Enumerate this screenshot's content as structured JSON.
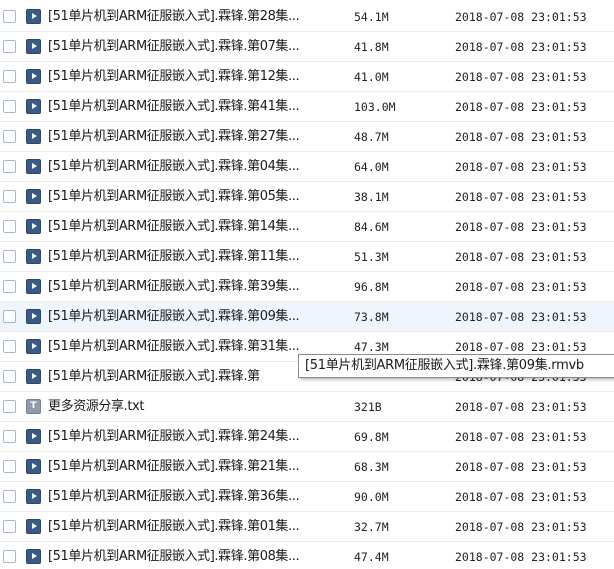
{
  "files": [
    {
      "name": "[51单片机到ARM征服嵌入式].霖锋.第28集...",
      "size": "54.1M",
      "date": "2018-07-08 23:01:53",
      "icon": "video-file-icon"
    },
    {
      "name": "[51单片机到ARM征服嵌入式].霖锋.第07集...",
      "size": "41.8M",
      "date": "2018-07-08 23:01:53",
      "icon": "video-file-icon"
    },
    {
      "name": "[51单片机到ARM征服嵌入式].霖锋.第12集...",
      "size": "41.0M",
      "date": "2018-07-08 23:01:53",
      "icon": "video-file-icon"
    },
    {
      "name": "[51单片机到ARM征服嵌入式].霖锋.第41集...",
      "size": "103.0M",
      "date": "2018-07-08 23:01:53",
      "icon": "video-file-icon"
    },
    {
      "name": "[51单片机到ARM征服嵌入式].霖锋.第27集...",
      "size": "48.7M",
      "date": "2018-07-08 23:01:53",
      "icon": "video-file-icon"
    },
    {
      "name": "[51单片机到ARM征服嵌入式].霖锋.第04集...",
      "size": "64.0M",
      "date": "2018-07-08 23:01:53",
      "icon": "video-file-icon"
    },
    {
      "name": "[51单片机到ARM征服嵌入式].霖锋.第05集...",
      "size": "38.1M",
      "date": "2018-07-08 23:01:53",
      "icon": "video-file-icon"
    },
    {
      "name": "[51单片机到ARM征服嵌入式].霖锋.第14集...",
      "size": "84.6M",
      "date": "2018-07-08 23:01:53",
      "icon": "video-file-icon"
    },
    {
      "name": "[51单片机到ARM征服嵌入式].霖锋.第11集...",
      "size": "51.3M",
      "date": "2018-07-08 23:01:53",
      "icon": "video-file-icon"
    },
    {
      "name": "[51单片机到ARM征服嵌入式].霖锋.第39集...",
      "size": "96.8M",
      "date": "2018-07-08 23:01:53",
      "icon": "video-file-icon"
    },
    {
      "name": "[51单片机到ARM征服嵌入式].霖锋.第09集...",
      "size": "73.8M",
      "date": "2018-07-08 23:01:53",
      "icon": "video-file-icon"
    },
    {
      "name": "[51单片机到ARM征服嵌入式].霖锋.第31集...",
      "size": "47.3M",
      "date": "2018-07-08 23:01:53",
      "icon": "video-file-icon"
    },
    {
      "name": "[51单片机到ARM征服嵌入式].霖锋.第",
      "size": "",
      "date": "2018-07-08 23:01:53",
      "icon": "video-file-icon"
    },
    {
      "name": "更多资源分享.txt",
      "size": "321B",
      "date": "2018-07-08 23:01:53",
      "icon": "text-file-icon"
    },
    {
      "name": "[51单片机到ARM征服嵌入式].霖锋.第24集...",
      "size": "69.8M",
      "date": "2018-07-08 23:01:53",
      "icon": "video-file-icon"
    },
    {
      "name": "[51单片机到ARM征服嵌入式].霖锋.第21集...",
      "size": "68.3M",
      "date": "2018-07-08 23:01:53",
      "icon": "video-file-icon"
    },
    {
      "name": "[51单片机到ARM征服嵌入式].霖锋.第36集...",
      "size": "90.0M",
      "date": "2018-07-08 23:01:53",
      "icon": "video-file-icon"
    },
    {
      "name": "[51单片机到ARM征服嵌入式].霖锋.第01集...",
      "size": "32.7M",
      "date": "2018-07-08 23:01:53",
      "icon": "video-file-icon"
    },
    {
      "name": "[51单片机到ARM征服嵌入式].霖锋.第08集...",
      "size": "47.4M",
      "date": "2018-07-08 23:01:53",
      "icon": "video-file-icon"
    }
  ],
  "hovered_index": 10,
  "tooltip": {
    "text": "[51单片机到ARM征服嵌入式].霖锋.第09集.rmvb"
  },
  "colors": {
    "hover_row": "#eef5fd",
    "video_icon": "#3a5a86",
    "text_icon": "#8f9bab"
  }
}
